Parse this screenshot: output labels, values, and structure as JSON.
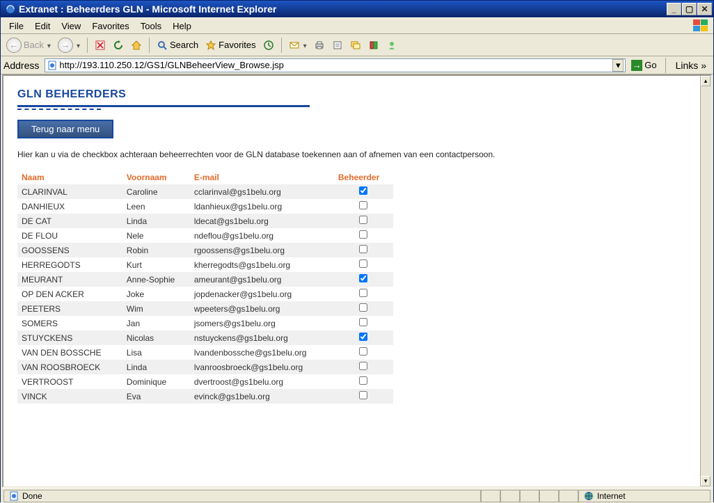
{
  "window": {
    "title": "Extranet : Beheerders GLN - Microsoft Internet Explorer"
  },
  "menu": {
    "items": [
      "File",
      "Edit",
      "View",
      "Favorites",
      "Tools",
      "Help"
    ]
  },
  "toolbar": {
    "back_label": "Back",
    "search_label": "Search",
    "favorites_label": "Favorites"
  },
  "addressbar": {
    "label": "Address",
    "url": "http://193.110.250.12/GS1/GLNBeheerView_Browse.jsp",
    "go_label": "Go",
    "links_label": "Links"
  },
  "page": {
    "title": "GLN BEHEERDERS",
    "back_button": "Terug naar menu",
    "intro": "Hier kan u via de checkbox achteraan beheerrechten voor de GLN database toekennen aan of afnemen van een contactpersoon.",
    "columns": {
      "naam": "Naam",
      "voornaam": "Voornaam",
      "email": "E-mail",
      "beheerder": "Beheerder"
    },
    "rows": [
      {
        "naam": "CLARINVAL",
        "voornaam": "Caroline",
        "email": "cclarinval@gs1belu.org",
        "beheerder": true
      },
      {
        "naam": "DANHIEUX",
        "voornaam": "Leen",
        "email": "ldanhieux@gs1belu.org",
        "beheerder": false
      },
      {
        "naam": "DE CAT",
        "voornaam": "Linda",
        "email": "ldecat@gs1belu.org",
        "beheerder": false
      },
      {
        "naam": "DE FLOU",
        "voornaam": "Nele",
        "email": "ndeflou@gs1belu.org",
        "beheerder": false
      },
      {
        "naam": "GOOSSENS",
        "voornaam": "Robin",
        "email": "rgoossens@gs1belu.org",
        "beheerder": false
      },
      {
        "naam": "HERREGODTS",
        "voornaam": "Kurt",
        "email": "kherregodts@gs1belu.org",
        "beheerder": false
      },
      {
        "naam": "MEURANT",
        "voornaam": "Anne-Sophie",
        "email": "ameurant@gs1belu.org",
        "beheerder": true
      },
      {
        "naam": "OP DEN ACKER",
        "voornaam": "Joke",
        "email": "jopdenacker@gs1belu.org",
        "beheerder": false
      },
      {
        "naam": "PEETERS",
        "voornaam": "Wim",
        "email": "wpeeters@gs1belu.org",
        "beheerder": false
      },
      {
        "naam": "SOMERS",
        "voornaam": "Jan",
        "email": "jsomers@gs1belu.org",
        "beheerder": false
      },
      {
        "naam": "STUYCKENS",
        "voornaam": "Nicolas",
        "email": "nstuyckens@gs1belu.org",
        "beheerder": true
      },
      {
        "naam": "VAN DEN BOSSCHE",
        "voornaam": "Lisa",
        "email": "lvandenbossche@gs1belu.org",
        "beheerder": false
      },
      {
        "naam": "VAN ROOSBROECK",
        "voornaam": "Linda",
        "email": "lvanroosbroeck@gs1belu.org",
        "beheerder": false
      },
      {
        "naam": "VERTROOST",
        "voornaam": "Dominique",
        "email": "dvertroost@gs1belu.org",
        "beheerder": false
      },
      {
        "naam": "VINCK",
        "voornaam": "Eva",
        "email": "evinck@gs1belu.org",
        "beheerder": false
      }
    ]
  },
  "statusbar": {
    "status": "Done",
    "zone": "Internet"
  }
}
